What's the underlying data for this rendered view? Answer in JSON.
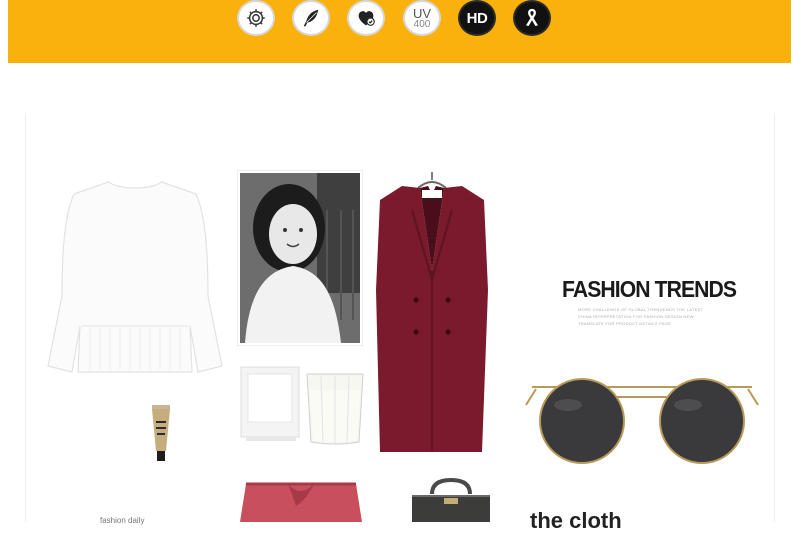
{
  "banner": {
    "background": "#fbb10b",
    "icons": [
      {
        "name": "gear-icon",
        "style": "light"
      },
      {
        "name": "feather-icon",
        "style": "light"
      },
      {
        "name": "heart-check-icon",
        "style": "light"
      },
      {
        "name": "uv400-icon",
        "style": "light",
        "text_top": "UV",
        "text_bottom": "400"
      },
      {
        "name": "hd-icon",
        "style": "dark",
        "text": "HD"
      },
      {
        "name": "ribbon-icon",
        "style": "dark"
      }
    ]
  },
  "collage": {
    "headline": "FASHION TRENDS",
    "subtext_lines": [
      "MORE CHALLENGE OF GLOBAL TRENDENDS THE LATEST",
      "CHINA INTERPRETATION FOR FASHION DESIGN NEW",
      "TRANSLATE FOR PRODUCT DETAILS PAGE"
    ],
    "bottom_text": "the cloth",
    "bottom_left_caption": "fashion daily",
    "items": [
      "white-blouse",
      "portrait-photo",
      "burgundy-vest",
      "empty-frame",
      "milk-glass",
      "cream-tube",
      "round-sunglasses",
      "pink-skirt",
      "leather-bag"
    ]
  }
}
